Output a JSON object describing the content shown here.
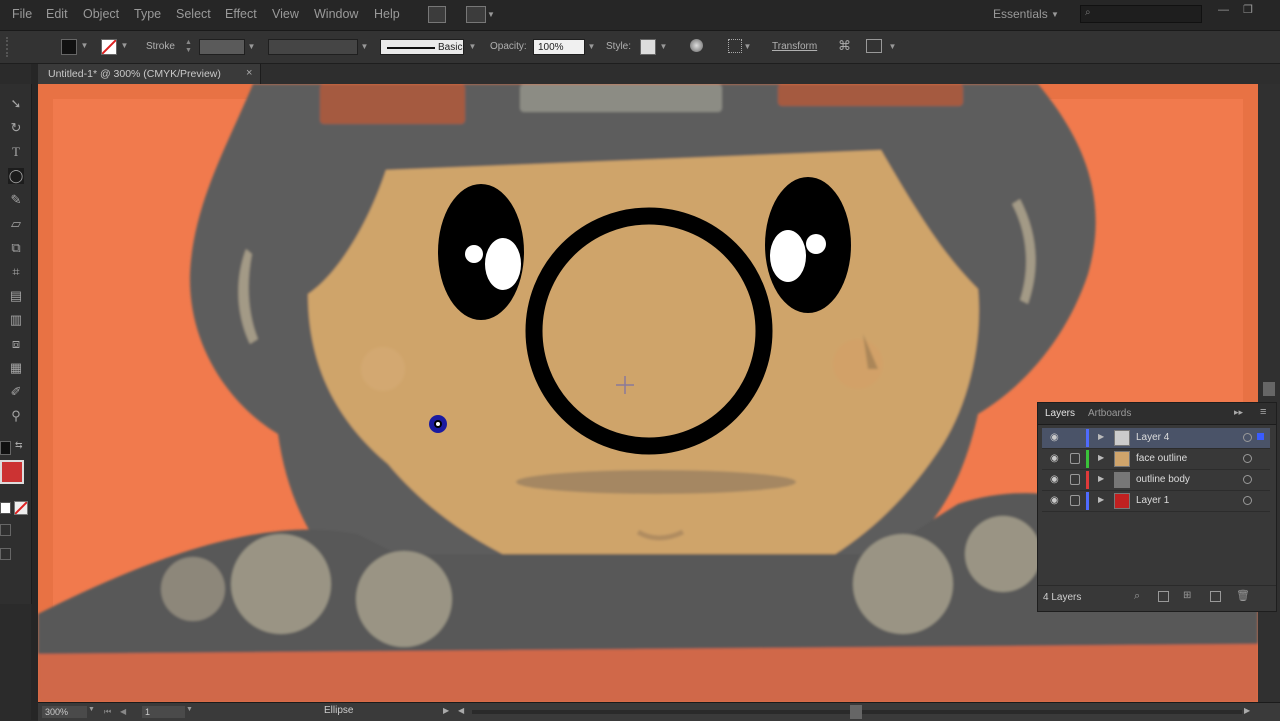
{
  "menu": {
    "items": [
      "File",
      "Edit",
      "Object",
      "Type",
      "Select",
      "Effect",
      "View",
      "Window",
      "Help"
    ],
    "workspace": "Essentials"
  },
  "control_bar": {
    "stroke_label": "Stroke",
    "brush_style": "Basic",
    "opacity_label": "Opacity:",
    "opacity_value": "100%",
    "style_label": "Style:",
    "transform_label": "Transform"
  },
  "document": {
    "tab_title": "Untitled-1* @ 300% (CMYK/Preview)",
    "close_glyph": "×"
  },
  "status": {
    "zoom": "300%",
    "artboard": "1",
    "tool": "Ellipse"
  },
  "layers_panel": {
    "tabs": [
      "Layers",
      "Artboards"
    ],
    "layers": [
      {
        "name": "Layer 4",
        "color": "#4f6bff",
        "selected": true
      },
      {
        "name": "face outline",
        "color": "#3ac23a",
        "selected": false
      },
      {
        "name": "outline body",
        "color": "#e03a3a",
        "selected": false
      },
      {
        "name": "Layer 1",
        "color": "#4f6bff",
        "selected": false
      }
    ],
    "footer": "4 Layers"
  },
  "colors": {
    "canvas_orange": "#f07a4c",
    "face_tan": "#cfa36a",
    "hair_gray": "#5e5e5e",
    "accent_orange": "#d67a32"
  }
}
